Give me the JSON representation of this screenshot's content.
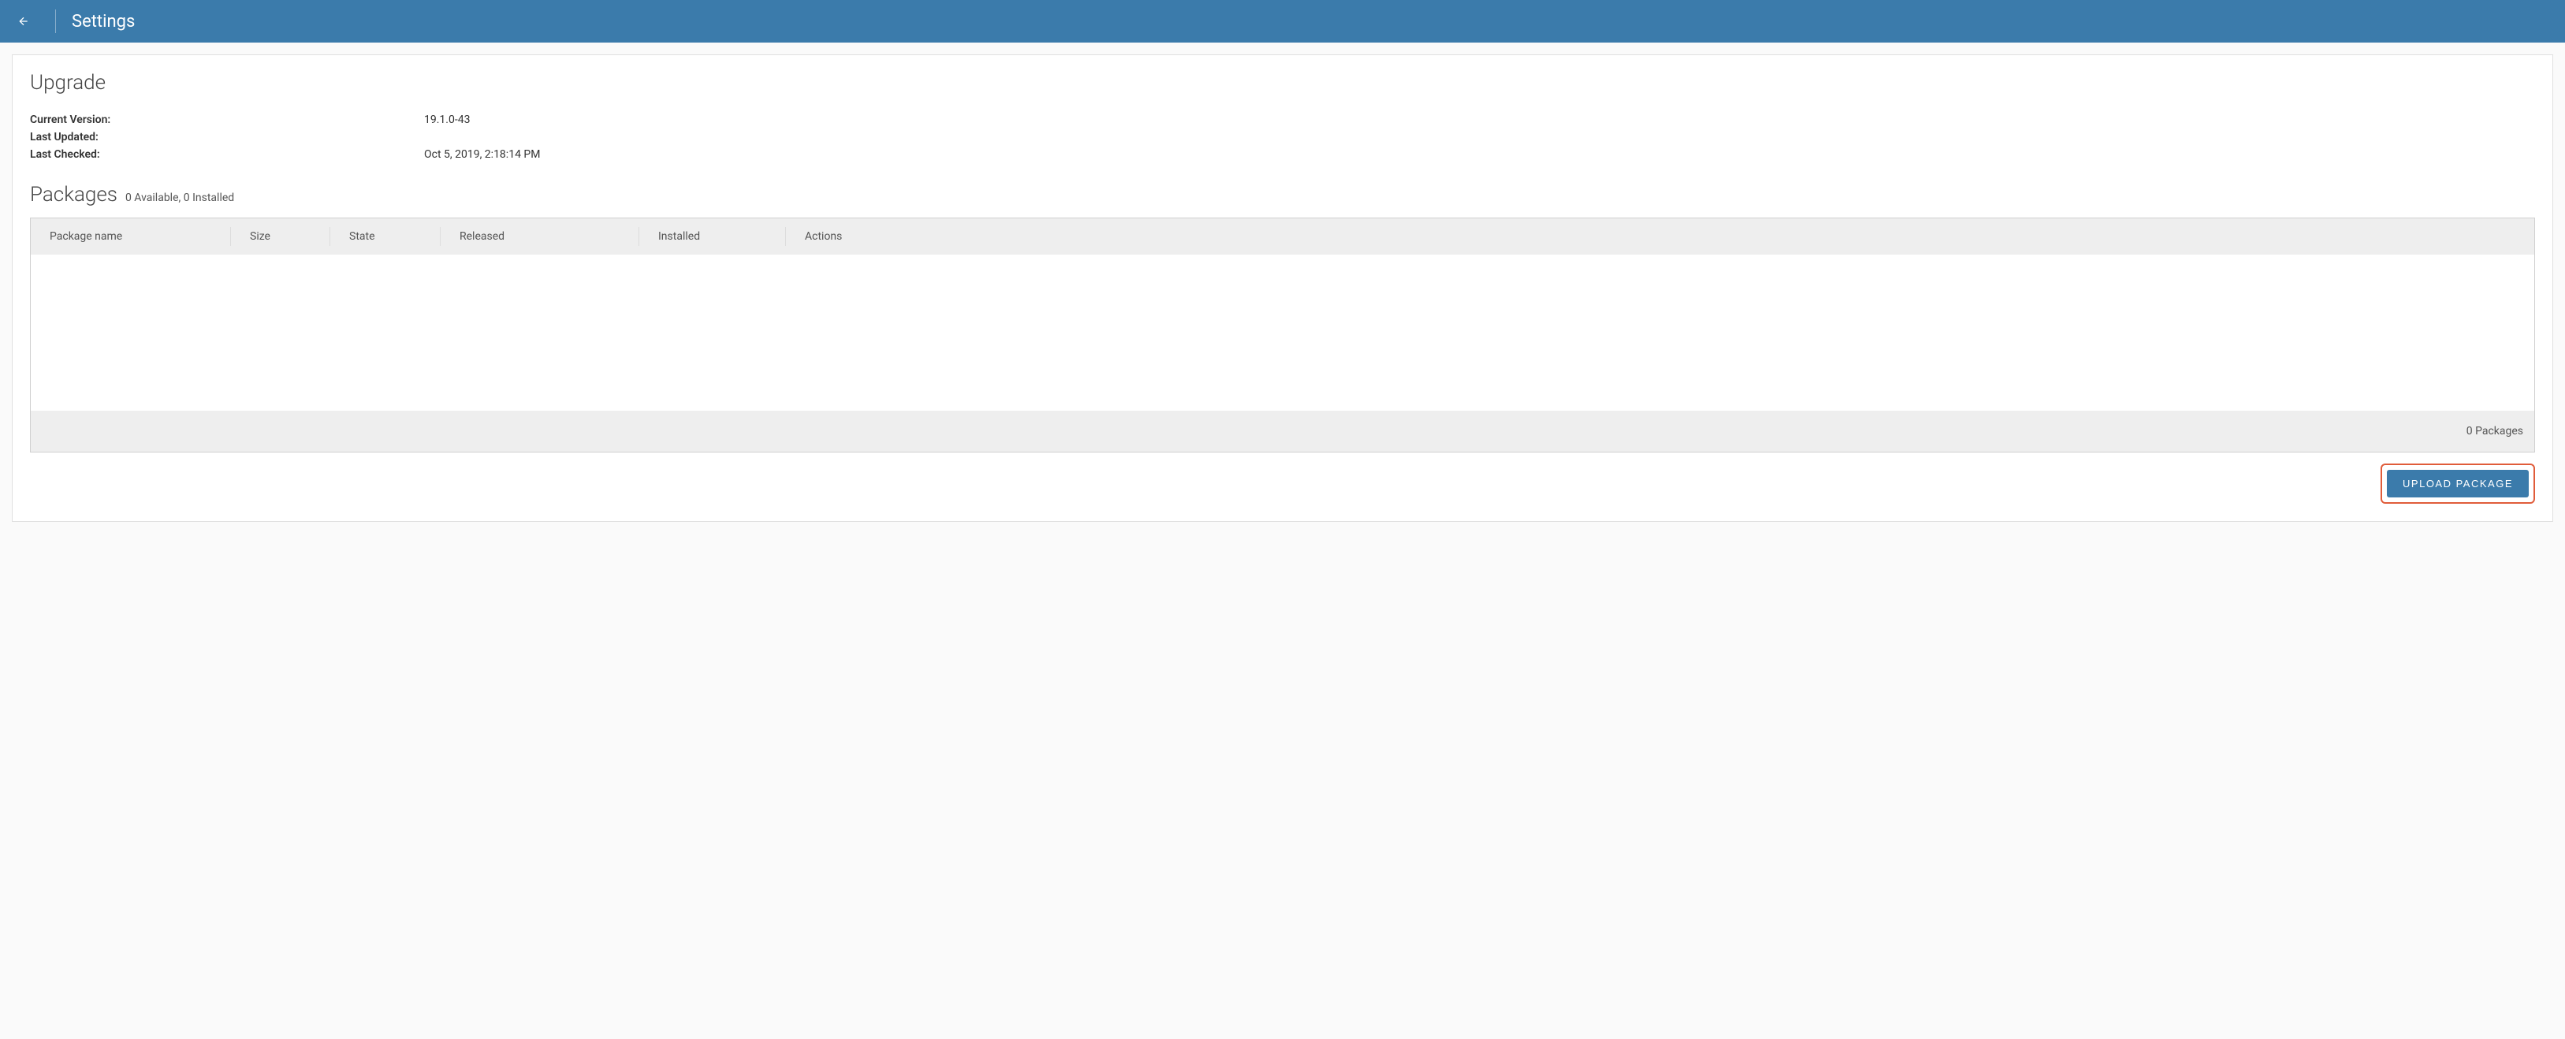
{
  "header": {
    "title": "Settings"
  },
  "upgrade": {
    "title": "Upgrade",
    "rows": [
      {
        "label": "Current Version:",
        "value": "19.1.0-43"
      },
      {
        "label": "Last Updated:",
        "value": ""
      },
      {
        "label": "Last Checked:",
        "value": "Oct 5, 2019, 2:18:14 PM"
      }
    ]
  },
  "packages": {
    "title": "Packages",
    "summary": "0 Available, 0 Installed",
    "columns": {
      "name": "Package name",
      "size": "Size",
      "state": "State",
      "released": "Released",
      "installed": "Installed",
      "actions": "Actions"
    },
    "footer": "0 Packages"
  },
  "actions": {
    "upload_label": "UPLOAD PACKAGE"
  }
}
